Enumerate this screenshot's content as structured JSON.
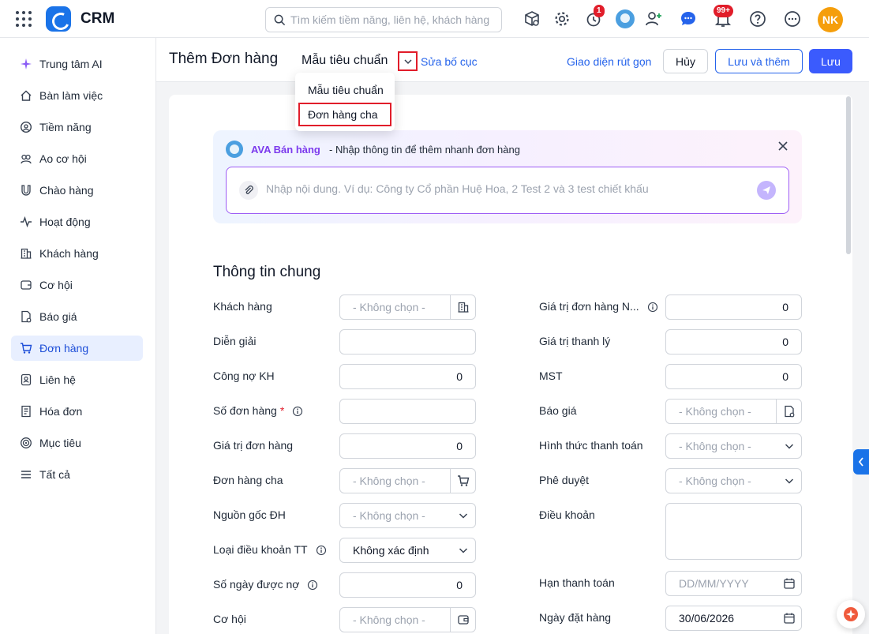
{
  "app": {
    "name": "CRM"
  },
  "topbar": {
    "search_placeholder": "Tìm kiếm tiềm năng, liên hệ, khách hàng",
    "reminder_badge": "1",
    "notification_badge": "99+",
    "user_initials": "NK"
  },
  "sidebar": {
    "items": [
      {
        "label": "Trung tâm AI",
        "icon": "sparkle-icon"
      },
      {
        "label": "Bàn làm việc",
        "icon": "home-icon"
      },
      {
        "label": "Tiềm năng",
        "icon": "target-user-icon"
      },
      {
        "label": "Ao cơ hội",
        "icon": "pool-icon"
      },
      {
        "label": "Chào hàng",
        "icon": "magnet-icon"
      },
      {
        "label": "Hoạt động",
        "icon": "activity-icon"
      },
      {
        "label": "Khách hàng",
        "icon": "building-icon"
      },
      {
        "label": "Cơ hội",
        "icon": "opportunity-icon"
      },
      {
        "label": "Báo giá",
        "icon": "quote-icon"
      },
      {
        "label": "Đơn hàng",
        "icon": "cart-icon",
        "active": true
      },
      {
        "label": "Liên hệ",
        "icon": "contact-icon"
      },
      {
        "label": "Hóa đơn",
        "icon": "invoice-icon"
      },
      {
        "label": "Mục tiêu",
        "icon": "goal-icon"
      },
      {
        "label": "Tất cả",
        "icon": "menu-icon"
      }
    ]
  },
  "header": {
    "title": "Thêm Đơn hàng",
    "template": "Mẫu tiêu chuẩn",
    "edit_layout": "Sửa bố cục",
    "compact_view": "Giao diện rút gọn",
    "cancel": "Hủy",
    "save_and_new": "Lưu và thêm",
    "save": "Lưu"
  },
  "template_menu": {
    "options": [
      "Mẫu tiêu chuẩn",
      "Đơn hàng cha"
    ],
    "highlighted": "Đơn hàng cha"
  },
  "ava": {
    "name": "AVA Bán hàng",
    "description": "- Nhập thông tin để thêm nhanh đơn hàng",
    "placeholder": "Nhập nội dung. Ví dụ: Công ty Cổ phần Huệ Hoa, 2 Test 2 và 3 test chiết khấu"
  },
  "form": {
    "section_title": "Thông tin chung",
    "left": [
      {
        "label": "Khách hàng",
        "type": "lookup",
        "value": "- Không chọn -",
        "suffix_icon": "building-icon"
      },
      {
        "label": "Diễn giải",
        "type": "text",
        "value": ""
      },
      {
        "label": "Công nợ KH",
        "type": "number",
        "value": "0"
      },
      {
        "label": "Số đơn hàng",
        "required": "*",
        "info": true,
        "type": "text",
        "value": ""
      },
      {
        "label": "Giá trị đơn hàng",
        "type": "number",
        "value": "0"
      },
      {
        "label": "Đơn hàng cha",
        "type": "lookup",
        "value": "- Không chọn -",
        "suffix_icon": "cart-icon"
      },
      {
        "label": "Nguồn gốc ĐH",
        "type": "select",
        "value": "- Không chọn -"
      },
      {
        "label": "Loại điều khoản TT",
        "info": true,
        "type": "select-filled",
        "value": "Không xác định"
      },
      {
        "label": "Số ngày được nợ",
        "info": true,
        "type": "number",
        "value": "0"
      },
      {
        "label": "Cơ hội",
        "type": "lookup",
        "value": "- Không chọn -",
        "suffix_icon": "wallet-icon"
      }
    ],
    "right": [
      {
        "label": "Giá trị đơn hàng N...",
        "info": true,
        "type": "number",
        "value": "0"
      },
      {
        "label": "Giá trị thanh lý",
        "type": "number",
        "value": "0"
      },
      {
        "label": "MST",
        "type": "number",
        "value": "0"
      },
      {
        "label": "Báo giá",
        "type": "lookup",
        "value": "- Không chọn -",
        "suffix_icon": "quote-icon"
      },
      {
        "label": "Hình thức thanh toán",
        "type": "select",
        "value": "- Không chọn -"
      },
      {
        "label": "Phê duyệt",
        "type": "select",
        "value": "- Không chọn -"
      },
      {
        "label": "Điều khoản",
        "type": "textarea",
        "value": ""
      },
      {
        "label": "Hạn thanh toán",
        "type": "date",
        "value": "DD/MM/YYYY",
        "placeholder": true
      },
      {
        "label": "Ngày đặt hàng",
        "type": "date",
        "value": "30/06/2026"
      }
    ]
  }
}
